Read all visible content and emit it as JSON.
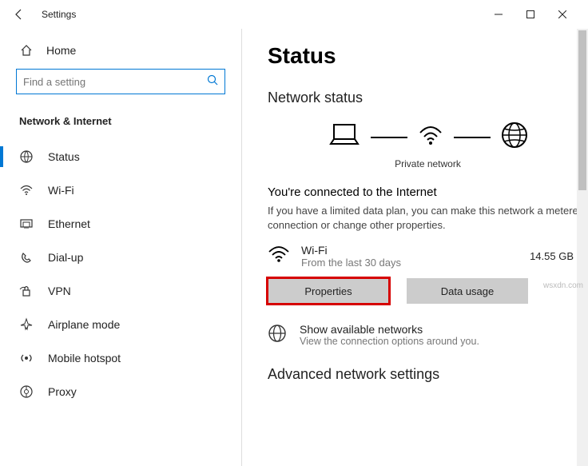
{
  "titlebar": {
    "title": "Settings"
  },
  "sidebar": {
    "home_label": "Home",
    "search_placeholder": "Find a setting",
    "category_label": "Network & Internet",
    "items": [
      {
        "label": "Status"
      },
      {
        "label": "Wi-Fi"
      },
      {
        "label": "Ethernet"
      },
      {
        "label": "Dial-up"
      },
      {
        "label": "VPN"
      },
      {
        "label": "Airplane mode"
      },
      {
        "label": "Mobile hotspot"
      },
      {
        "label": "Proxy"
      }
    ]
  },
  "main": {
    "page_title": "Status",
    "section_heading": "Network status",
    "diagram_label": "Private network",
    "connected_heading": "You're connected to the Internet",
    "connected_body": "If you have a limited data plan, you can make this network a metered connection or change other properties.",
    "connection": {
      "name": "Wi-Fi",
      "sub": "From the last 30 days",
      "usage": "14.55 GB"
    },
    "btn_properties": "Properties",
    "btn_data_usage": "Data usage",
    "show_networks_title": "Show available networks",
    "show_networks_sub": "View the connection options around you.",
    "advanced_heading": "Advanced network settings"
  },
  "watermark": "wsxdn.com"
}
